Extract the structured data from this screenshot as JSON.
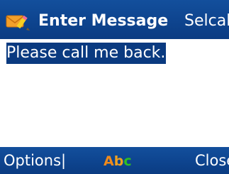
{
  "header": {
    "icon": "message-envelope-pencil-icon",
    "title": "Enter Message",
    "right_label": "Selcall"
  },
  "message": {
    "text": "Please call me back.",
    "selected": true
  },
  "softkeys": {
    "left_label": "Options|",
    "right_label": "Close",
    "input_mode": {
      "a": "A",
      "b": "b",
      "c": "c"
    }
  },
  "colors": {
    "bar_blue": "#0e4590",
    "selection_blue": "#0a3a80",
    "mode_a": "#f08a1c",
    "mode_b": "#f0a020",
    "mode_c": "#30c020"
  }
}
